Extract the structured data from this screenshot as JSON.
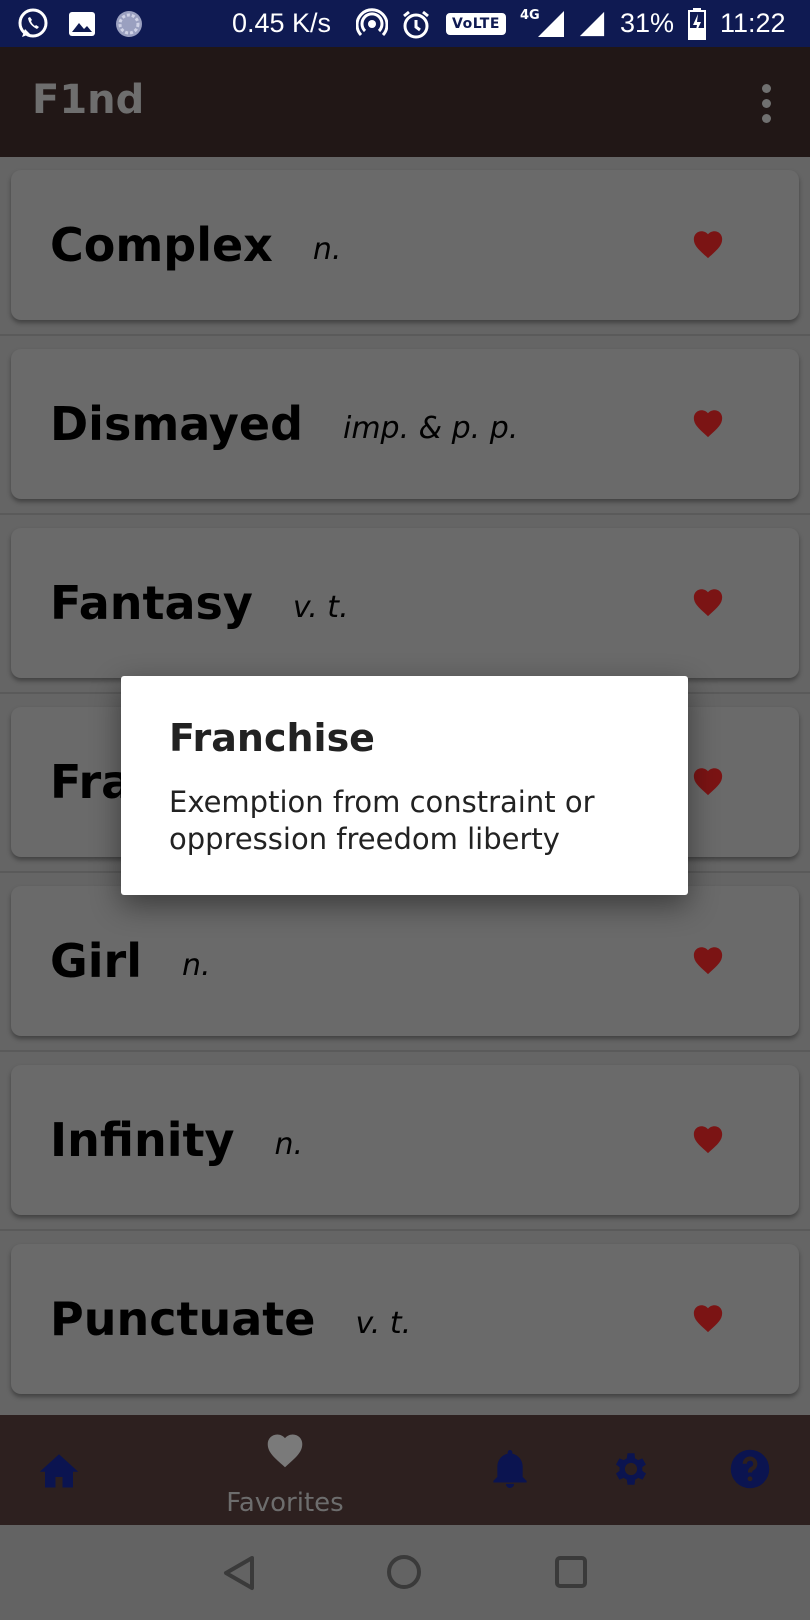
{
  "status_bar": {
    "net_speed": "0.45 K/s",
    "volte": "VoLTE",
    "network": "4G",
    "battery": "31%",
    "time": "11:22",
    "icons": [
      "whatsapp-icon",
      "gallery-icon",
      "sync-icon",
      "hotspot-icon",
      "alarm-icon",
      "signal-icon",
      "battery-charging-icon"
    ]
  },
  "app_bar": {
    "title": "F1nd",
    "menu_icon": "more-vert-icon"
  },
  "words": [
    {
      "word": "Complex",
      "pos": "n.",
      "favorite": true
    },
    {
      "word": "Dismayed",
      "pos": "imp. & p. p.",
      "favorite": true
    },
    {
      "word": "Fantasy",
      "pos": "v. t.",
      "favorite": true
    },
    {
      "word": "Fra",
      "pos": "",
      "favorite": true
    },
    {
      "word": "Girl",
      "pos": "n.",
      "favorite": true
    },
    {
      "word": "Infinity",
      "pos": "n.",
      "favorite": true
    },
    {
      "word": "Punctuate",
      "pos": "v. t.",
      "favorite": true
    }
  ],
  "dialog": {
    "title": "Franchise",
    "definition": "Exemption from constraint or oppression freedom liberty"
  },
  "bottom_nav": {
    "active_label": "Favorites",
    "items": [
      "home-icon",
      "favorites-icon",
      "notifications-icon",
      "settings-icon",
      "help-icon"
    ]
  },
  "colors": {
    "status_bar": "#0f1a52",
    "app_bar": "#211716",
    "bottom_nav": "#2d201f",
    "heart": "#7b1414",
    "nav_icon": "#0b1450"
  }
}
